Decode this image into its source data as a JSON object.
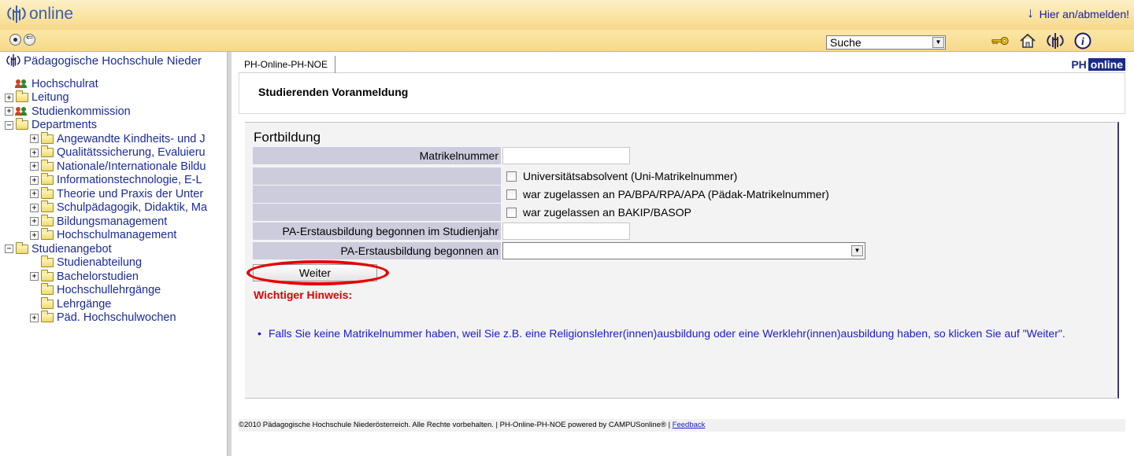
{
  "brand": {
    "logo_text": "online"
  },
  "topbar": {
    "login_label": "Hier an/abmelden!"
  },
  "toolbar": {
    "search_value": "Suche",
    "icons": [
      "key-icon",
      "home-icon",
      "ph-icon",
      "info-icon"
    ]
  },
  "sidebar": {
    "root_label": "Pädagogische Hochschule Nieder",
    "items": [
      {
        "label": "Hochschulrat",
        "icon": "people-icon",
        "level": 0,
        "toggle": ""
      },
      {
        "label": "Leitung",
        "icon": "folder-icon",
        "level": 0,
        "toggle": "+"
      },
      {
        "label": "Studienkommission",
        "icon": "people-icon",
        "level": 0,
        "toggle": "+"
      },
      {
        "label": "Departments",
        "icon": "folder-icon",
        "level": 0,
        "toggle": "−"
      },
      {
        "label": "Angewandte Kindheits- und J",
        "icon": "folder-icon",
        "level": 1,
        "toggle": "+"
      },
      {
        "label": "Qualitätssicherung, Evaluieru",
        "icon": "folder-icon",
        "level": 1,
        "toggle": "+"
      },
      {
        "label": "Nationale/Internationale Bildu",
        "icon": "folder-icon",
        "level": 1,
        "toggle": "+"
      },
      {
        "label": "Informationstechnologie, E-L",
        "icon": "folder-icon",
        "level": 1,
        "toggle": "+"
      },
      {
        "label": "Theorie und Praxis der Unter",
        "icon": "folder-icon",
        "level": 1,
        "toggle": "+"
      },
      {
        "label": "Schulpädagogik, Didaktik, Ma",
        "icon": "folder-icon",
        "level": 1,
        "toggle": "+"
      },
      {
        "label": "Bildungsmanagement",
        "icon": "folder-icon",
        "level": 1,
        "toggle": "+"
      },
      {
        "label": "Hochschulmanagement",
        "icon": "folder-icon",
        "level": 1,
        "toggle": "+"
      },
      {
        "label": "Studienangebot",
        "icon": "folder-icon",
        "level": 0,
        "toggle": "−"
      },
      {
        "label": "Studienabteilung",
        "icon": "folder-icon",
        "level": 1,
        "toggle": ""
      },
      {
        "label": "Bachelorstudien",
        "icon": "folder-icon",
        "level": 1,
        "toggle": "+"
      },
      {
        "label": "Hochschullehrgänge",
        "icon": "folder-icon",
        "level": 1,
        "toggle": ""
      },
      {
        "label": "Lehrgänge",
        "icon": "folder-icon",
        "level": 1,
        "toggle": ""
      },
      {
        "label": "Päd. Hochschulwochen",
        "icon": "folder-icon",
        "level": 1,
        "toggle": "+"
      }
    ]
  },
  "main": {
    "tab_label": "PH-Online-PH-NOE",
    "ph_logo": {
      "part1": "PH",
      "part2": "online"
    },
    "page_title": "Studierenden Voranmeldung",
    "section_title": "Fortbildung",
    "form": {
      "matrikel_label": "Matrikelnummer",
      "matrikel_value": "",
      "check1": "Universitätsabsolvent (Uni-Matrikelnummer)",
      "check2": "war zugelassen an PA/BPA/RPA/APA (Pädak-Matrikelnummer)",
      "check3": "war zugelassen an BAKIP/BASOP",
      "pa_year_label": "PA-Erstausbildung begonnen im Studienjahr",
      "pa_year_value": "",
      "pa_at_label": "PA-Erstausbildung begonnen an",
      "pa_at_value": ""
    },
    "weiter_label": "Weiter",
    "hint_title": "Wichtiger Hinweis:",
    "hint_bullet": "•",
    "hint_text": "Falls Sie keine Matrikelnummer haben, weil Sie z.B. eine Religionslehrer(innen)ausbildung oder eine Werklehr(innen)ausbildung haben, so klicken Sie auf \"Weiter\"."
  },
  "footer": {
    "text": "©2010 Pädagogische Hochschule Niederösterreich. Alle Rechte vorbehalten. | PH-Online-PH-NOE powered by CAMPUSonline® | ",
    "feedback_label": "Feedback"
  }
}
